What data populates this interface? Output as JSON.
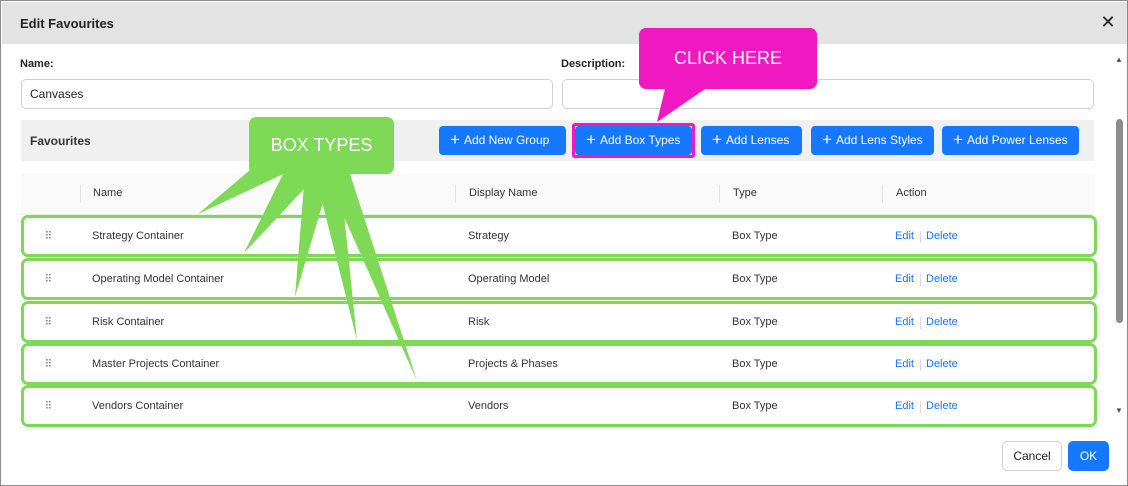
{
  "dialog": {
    "title": "Edit Favourites",
    "close_symbol": "✕"
  },
  "form": {
    "name_label": "Name:",
    "name_value": "Canvases",
    "description_label": "Description:",
    "description_value": ""
  },
  "favourites": {
    "label": "Favourites",
    "buttons": [
      {
        "label": "Add New Group",
        "icon": "plus-icon"
      },
      {
        "label": "Add Box Types",
        "icon": "plus-icon"
      },
      {
        "label": "Add Lenses",
        "icon": "plus-icon"
      },
      {
        "label": "Add Lens Styles",
        "icon": "plus-icon"
      },
      {
        "label": "Add Power Lenses",
        "icon": "plus-icon"
      }
    ]
  },
  "table": {
    "columns": [
      "Name",
      "Display Name",
      "Type",
      "Action"
    ],
    "rows": [
      {
        "name": "Strategy Container",
        "display": "Strategy",
        "type": "Box Type",
        "edit": "Edit",
        "delete": "Delete"
      },
      {
        "name": "Operating Model Container",
        "display": "Operating Model",
        "type": "Box Type",
        "edit": "Edit",
        "delete": "Delete"
      },
      {
        "name": "Risk Container",
        "display": "Risk",
        "type": "Box Type",
        "edit": "Edit",
        "delete": "Delete"
      },
      {
        "name": "Master Projects Container",
        "display": "Projects & Phases",
        "type": "Box Type",
        "edit": "Edit",
        "delete": "Delete"
      },
      {
        "name": "Vendors Container",
        "display": "Vendors",
        "type": "Box Type",
        "edit": "Edit",
        "delete": "Delete"
      }
    ]
  },
  "footer": {
    "cancel_label": "Cancel",
    "ok_label": "OK"
  },
  "annotations": {
    "click_here": "CLICK HERE",
    "box_types": "BOX TYPES"
  },
  "colors": {
    "primary": "#1677ff",
    "highlight_pink": "#f018c0",
    "highlight_green": "#7ed957"
  }
}
